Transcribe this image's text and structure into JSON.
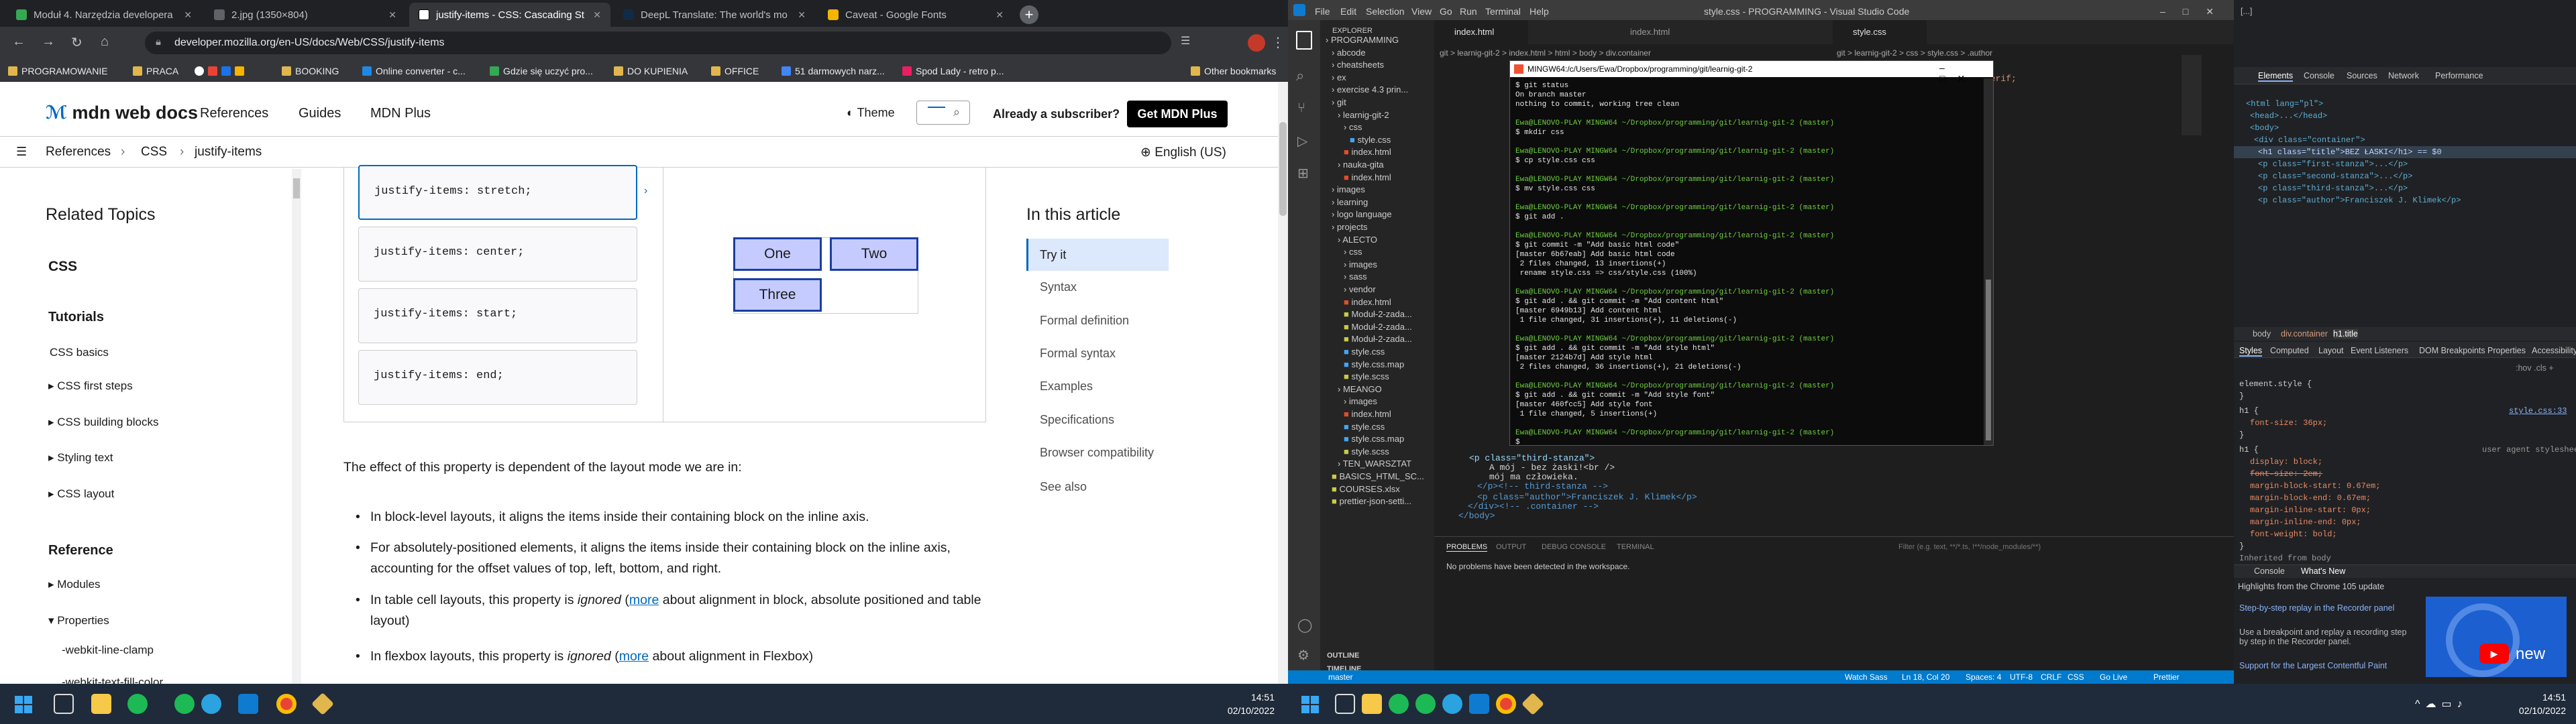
{
  "chrome": {
    "tabs": [
      {
        "title": "Moduł 4. Narzędzia developera",
        "color": "#34a853"
      },
      {
        "title": "2.jpg (1350×804)",
        "color": "#5f6368"
      },
      {
        "title": "justify-items - CSS: Cascading St",
        "color": "#ffffff"
      },
      {
        "title": "DeepL Translate: The world's mo",
        "color": "#0f2b46"
      },
      {
        "title": "Caveat - Google Fonts",
        "color": "#f4b400"
      }
    ],
    "url": "developer.mozilla.org/en-US/docs/Web/CSS/justify-items",
    "bookmarks": [
      "PROGRAMOWANIE",
      "PRACA",
      "BOOKING",
      "Online converter - c...",
      "Gdzie się uczyć pro...",
      "DO KUPIENIA",
      "OFFICE",
      "51 darmowych narz...",
      "Spod Lady - retro p..."
    ],
    "other_bookmarks": "Other bookmarks"
  },
  "mdn": {
    "logo": "mdn web docs",
    "nav": [
      "References",
      "Guides",
      "MDN Plus"
    ],
    "theme": "Theme",
    "subscriber": "Already a subscriber?",
    "cta": "Get MDN Plus",
    "breadcrumbs": [
      "References",
      "CSS",
      "justify-items"
    ],
    "language": "English (US)",
    "sidebar": {
      "related": "Related Topics",
      "css": "CSS",
      "tutorials": "Tutorials",
      "items": [
        "CSS basics",
        "CSS first steps",
        "CSS building blocks",
        "Styling text",
        "CSS layout"
      ],
      "reference": "Reference",
      "ref_items": [
        "Modules",
        "Properties",
        "-webkit-line-clamp",
        "-webkit-text-fill-color"
      ]
    },
    "examples": [
      "justify-items: stretch;",
      "justify-items: center;",
      "justify-items: start;",
      "justify-items: end;"
    ],
    "grid_cells": [
      "One",
      "Two",
      "Three"
    ],
    "intro": "The effect of this property is dependent of the layout mode we are in:",
    "bullets": [
      {
        "text": "In block-level layouts, it aligns the items inside their containing block on the inline axis."
      },
      {
        "text": "For absolutely-positioned elements, it aligns the items inside their containing block on the inline axis, accounting for the offset values of top, left, bottom, and right."
      },
      {
        "pre": "In table cell layouts, this property is ",
        "em": "ignored",
        "mid": " (",
        "link": "more",
        "post": " about alignment in block, absolute positioned and table layout)"
      },
      {
        "pre": "In flexbox layouts, this property is ",
        "em": "ignored",
        "mid": " (",
        "link": "more",
        "post": " about alignment in Flexbox)"
      }
    ],
    "toc_title": "In this article",
    "toc": [
      "Try it",
      "Syntax",
      "Formal definition",
      "Formal syntax",
      "Examples",
      "Specifications",
      "Browser compatibility",
      "See also"
    ]
  },
  "taskbar_left": {
    "time": "14:51",
    "date": "02/10/2022"
  },
  "taskbar_right": {
    "time": "14:51",
    "date": "02/10/2022"
  },
  "vscode": {
    "title": "style.css - PROGRAMMING - Visual Studio Code",
    "menu": [
      "File",
      "Edit",
      "Selection",
      "View",
      "Go",
      "Run",
      "Terminal",
      "Help"
    ],
    "explorer_title": "EXPLORER",
    "tree": [
      "PROGRAMMING",
      "abcode",
      "cheatsheets",
      "ex",
      "exercise 4.3 prin...",
      "git",
      "learnig-git-2",
      "css",
      "style.css",
      "index.html",
      "nauka-gita",
      "index.html",
      "images",
      "learning",
      "logo language",
      "projects",
      "ALECTO",
      "css",
      "images",
      "sass",
      "vendor",
      "index.html",
      "Moduł-2-zada...",
      "Moduł-2-zada...",
      "Moduł-2-zada...",
      "style.css",
      "style.css.map",
      "style.scss",
      "MEANGO",
      "images",
      "index.html",
      "style.css",
      "style.css.map",
      "style.scss",
      "TEN_WARSZTAT",
      "BASICS_HTML_SC...",
      "COURSES.xlsx",
      "prettier-json-setti..."
    ],
    "outline": "OUTLINE",
    "timeline": "TIMELINE",
    "tabs": [
      "index.html",
      "index.html",
      "style.css"
    ],
    "breadcrumb": "git > learnig-git-2 > index.html > html > body > div.container",
    "breadcrumb2": "git > learnig-git-2 > css > style.css > .author",
    "code_lines": [
      "<p class=\"third-stanza\">",
      "    A mój - bez żaski!<br />",
      "    mój ma człowieka.",
      "</p><!-- third-stanza -->",
      "<p class=\"author\">Franciszek J. Klimek</p>",
      "</div><!-- .container -->",
      "</body>"
    ],
    "panel_tabs": [
      "PROBLEMS",
      "OUTPUT",
      "DEBUG CONSOLE",
      "TERMINAL"
    ],
    "panel_filter": "Filter (e.g. text, **/*.ts, !**/node_modules/**)",
    "problems": "No problems have been detected in the workspace.",
    "status": [
      "master",
      "Watch Sass",
      "Ln 18, Col 20",
      "Spaces: 4",
      "UTF-8",
      "CRLF",
      "CSS",
      "Go Live",
      "Prettier"
    ]
  },
  "terminal": {
    "title": "MINGW64:/c/Users/Ewa/Dropbox/programming/git/learnig-git-2",
    "lines": [
      {
        "t": "$ git status",
        "c": ""
      },
      {
        "t": "On branch master",
        "c": ""
      },
      {
        "t": "nothing to commit, working tree clean",
        "c": ""
      },
      {
        "t": "",
        "c": ""
      },
      {
        "t": "Ewa@LENOVO-PLAY MINGW64 ~/Dropbox/programming/git/learnig-git-2 (master)",
        "c": "p"
      },
      {
        "t": "$ mkdir css",
        "c": ""
      },
      {
        "t": "",
        "c": ""
      },
      {
        "t": "Ewa@LENOVO-PLAY MINGW64 ~/Dropbox/programming/git/learnig-git-2 (master)",
        "c": "p"
      },
      {
        "t": "$ cp style.css css",
        "c": ""
      },
      {
        "t": "",
        "c": ""
      },
      {
        "t": "Ewa@LENOVO-PLAY MINGW64 ~/Dropbox/programming/git/learnig-git-2 (master)",
        "c": "p"
      },
      {
        "t": "$ mv style.css css",
        "c": ""
      },
      {
        "t": "",
        "c": ""
      },
      {
        "t": "Ewa@LENOVO-PLAY MINGW64 ~/Dropbox/programming/git/learnig-git-2 (master)",
        "c": "p"
      },
      {
        "t": "$ git add .",
        "c": ""
      },
      {
        "t": "",
        "c": ""
      },
      {
        "t": "Ewa@LENOVO-PLAY MINGW64 ~/Dropbox/programming/git/learnig-git-2 (master)",
        "c": "p"
      },
      {
        "t": "$ git commit -m \"Add basic html code\"",
        "c": ""
      },
      {
        "t": "[master 6b67eab] Add basic html code",
        "c": ""
      },
      {
        "t": " 2 files changed, 13 insertions(+)",
        "c": ""
      },
      {
        "t": " rename style.css => css/style.css (100%)",
        "c": ""
      },
      {
        "t": "",
        "c": ""
      },
      {
        "t": "Ewa@LENOVO-PLAY MINGW64 ~/Dropbox/programming/git/learnig-git-2 (master)",
        "c": "p"
      },
      {
        "t": "$ git add . && git commit -m \"Add content html\"",
        "c": ""
      },
      {
        "t": "[master 6949b13] Add content html",
        "c": ""
      },
      {
        "t": " 1 file changed, 31 insertions(+), 11 deletions(-)",
        "c": ""
      },
      {
        "t": "",
        "c": ""
      },
      {
        "t": "Ewa@LENOVO-PLAY MINGW64 ~/Dropbox/programming/git/learnig-git-2 (master)",
        "c": "p"
      },
      {
        "t": "$ git add . && git commit -m \"Add style html\"",
        "c": ""
      },
      {
        "t": "[master 2124b7d] Add style html",
        "c": ""
      },
      {
        "t": " 2 files changed, 36 insertions(+), 21 deletions(-)",
        "c": ""
      },
      {
        "t": "",
        "c": ""
      },
      {
        "t": "Ewa@LENOVO-PLAY MINGW64 ~/Dropbox/programming/git/learnig-git-2 (master)",
        "c": "p"
      },
      {
        "t": "$ git add . && git commit -m \"Add style font\"",
        "c": ""
      },
      {
        "t": "[master 460fcc5] Add style font",
        "c": ""
      },
      {
        "t": " 1 file changed, 5 insertions(+)",
        "c": ""
      },
      {
        "t": "",
        "c": ""
      },
      {
        "t": "Ewa@LENOVO-PLAY MINGW64 ~/Dropbox/programming/git/learnig-git-2 (master)",
        "c": "p"
      },
      {
        "t": "$ ",
        "c": ""
      }
    ]
  },
  "devtools": {
    "tabs": [
      "Elements",
      "Console",
      "Sources",
      "Network",
      "Performance"
    ],
    "dom": [
      "<html lang=\"pl\">",
      "<head>...</head>",
      "<body>",
      "<div class=\"container\">",
      "<h1 class=\"title\">BEZ ŁASKI</h1> == $0",
      "<p class=\"first-stanza\">...</p>",
      "<p class=\"second-stanza\">...</p>",
      "<p class=\"third-stanza\">...</p>",
      "<p class=\"author\">Franciszek J. Klimek</p>"
    ],
    "crumbs": [
      "body",
      "div.container",
      "h1.title"
    ],
    "style_tabs": [
      "Styles",
      "Computed",
      "Layout",
      "Event Listeners",
      "DOM Breakpoints",
      "Properties",
      "Accessibility"
    ],
    "filter": ":hov .cls + ",
    "rules": [
      "element.style {",
      "}",
      "h1 {",
      "font-size: 36px;",
      "}",
      "h1 {",
      "display: block;",
      "font-size: 2em;",
      "margin-block-start: 0.67em;",
      "margin-block-end: 0.67em;",
      "margin-inline-start: 0px;",
      "margin-inline-end: 0px;",
      "font-weight: bold;",
      "}",
      "Inherited from body"
    ],
    "source": "style.css:33",
    "ua": "user agent stylesheet",
    "drawer_tabs": [
      "Console",
      "What's New"
    ],
    "whatsnew": "Highlights from the Chrome 105 update",
    "news": [
      "Step-by-step replay in the Recorder panel",
      "Use a breakpoint and replay a recording step by step in the Recorder panel.",
      "Support for the Largest Contentful Paint"
    ],
    "video_label": "new"
  }
}
